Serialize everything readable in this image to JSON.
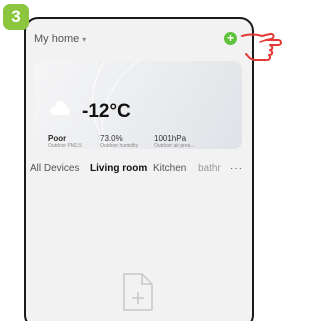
{
  "step": "3",
  "header": {
    "home_name": "My home",
    "caret": "▾",
    "add_symbol": "+"
  },
  "weather": {
    "temperature": "-12°C",
    "condition_icon": "cloud-icon",
    "stats": [
      {
        "value": "Poor",
        "label": "Outdoor PM2.5"
      },
      {
        "value": "73.0%",
        "label": "Outdoor humidity"
      },
      {
        "value": "1001hPa",
        "label": "Outdoor air prea..."
      }
    ]
  },
  "tabs": [
    "All Devices",
    "Living room",
    "Kitchen",
    "bathr"
  ],
  "active_tab": "Living room",
  "more_label": "···",
  "empty_state_icon": "document-plus-icon",
  "pointer_icon": "hand-pointer-icon",
  "colors": {
    "accent_green": "#5ec23a",
    "badge_green": "#8cc63f",
    "pointer_red": "#e53935"
  }
}
